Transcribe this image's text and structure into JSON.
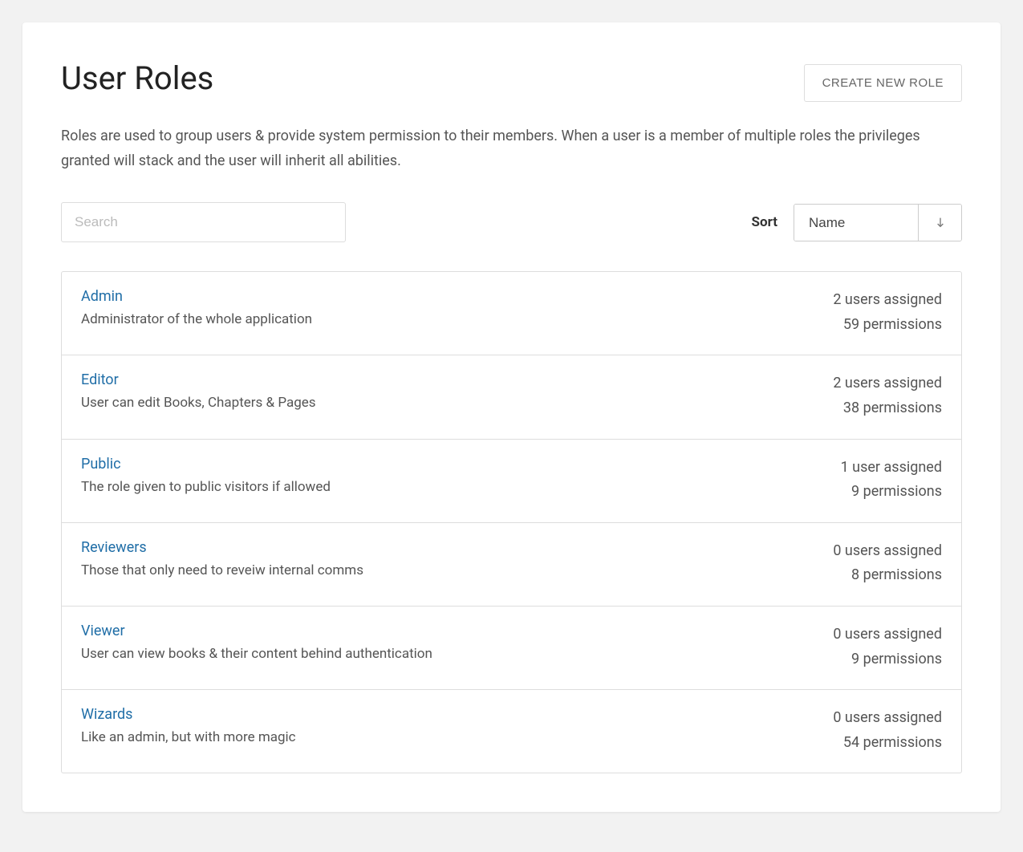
{
  "header": {
    "title": "User Roles",
    "create_button": "Create New Role"
  },
  "description": "Roles are used to group users & provide system permission to their members. When a user is a member of multiple roles the privileges granted will stack and the user will inherit all abilities.",
  "search": {
    "placeholder": "Search",
    "value": ""
  },
  "sort": {
    "label": "Sort",
    "selected": "Name",
    "direction": "asc"
  },
  "roles": [
    {
      "name": "Admin",
      "description": "Administrator of the whole application",
      "users_text": "2 users assigned",
      "permissions_text": "59 permissions"
    },
    {
      "name": "Editor",
      "description": "User can edit Books, Chapters & Pages",
      "users_text": "2 users assigned",
      "permissions_text": "38 permissions"
    },
    {
      "name": "Public",
      "description": "The role given to public visitors if allowed",
      "users_text": "1 user assigned",
      "permissions_text": "9 permissions"
    },
    {
      "name": "Reviewers",
      "description": "Those that only need to reveiw internal comms",
      "users_text": "0 users assigned",
      "permissions_text": "8 permissions"
    },
    {
      "name": "Viewer",
      "description": "User can view books & their content behind authentication",
      "users_text": "0 users assigned",
      "permissions_text": "9 permissions"
    },
    {
      "name": "Wizards",
      "description": "Like an admin, but with more magic",
      "users_text": "0 users assigned",
      "permissions_text": "54 permissions"
    }
  ]
}
